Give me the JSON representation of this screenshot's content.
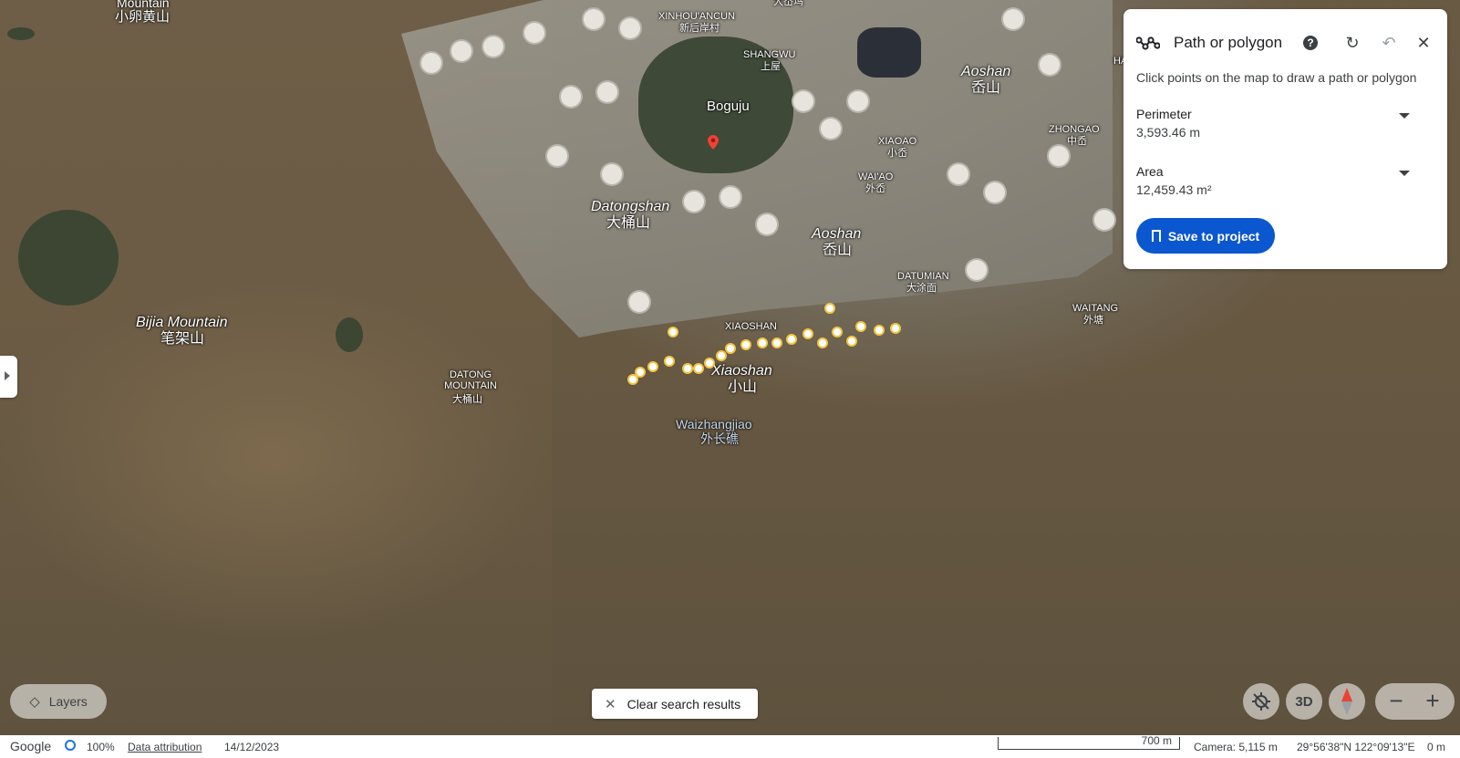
{
  "map": {
    "labels": {
      "mountain_top": "Mountain",
      "xiaoluanhuangshan": "小卵黄山",
      "xinhouancun_en": "XINHOU'ANCUN",
      "xinhouancun_zh": "新后岸村",
      "dazhu": "大岙坞",
      "shangwu_en": "SHANGWU",
      "shangwu_zh": "上屋",
      "boguju": "Boguju",
      "aoshan_top_en": "Aoshan",
      "aoshan_top_zh": "岙山",
      "zhongao_en": "ZHONGAO",
      "zhongao_zh": "中岙",
      "xiaoao_en": "XIAOAO",
      "xiaoao_zh": "小岙",
      "waiao_en": "WAI'AO",
      "waiao_zh": "外岙",
      "datongshan_en": "Datongshan",
      "datongshan_zh": "大桶山",
      "aoshan_mid_en": "Aoshan",
      "aoshan_mid_zh": "岙山",
      "datumian_en": "DATUMIAN",
      "datumian_zh": "大涂面",
      "waitang_en": "WAITANG",
      "waitang_zh": "外塘",
      "bijia_en": "Bijia Mountain",
      "bijia_zh": "笔架山",
      "xiaoshan_caps": "XIAOSHAN",
      "xiaoshan_en": "Xiaoshan",
      "xiaoshan_zh": "小山",
      "datong_mountain_en": "DATONG MOUNTAIN",
      "datong_mountain_zh": "大桶山",
      "waizhangjiao_en": "Waizhangjiao",
      "waizhangjiao_zh": "外长礁",
      "ha_edge": "HA"
    }
  },
  "measure_panel": {
    "title": "Path or polygon",
    "hint": "Click points on the map to draw a path or polygon",
    "perimeter_label": "Perimeter",
    "perimeter_value": "3,593.46 m",
    "area_label": "Area",
    "area_value": "12,459.43 m²",
    "save_label": "Save to project"
  },
  "controls": {
    "layers_label": "Layers",
    "clear_label": "Clear search results",
    "three_d_label": "3D"
  },
  "footer": {
    "brand": "Google",
    "percent": "100%",
    "attribution": "Data attribution",
    "date": "14/12/2023",
    "scale_label": "700 m",
    "camera": "Camera: 5,115 m",
    "coords": "29°56'38\"N 122°09'13\"E",
    "elevation": "0 m"
  },
  "colors": {
    "accent": "#0b57d0",
    "path_outline": "#f2c641",
    "marker": "#ea4335"
  }
}
